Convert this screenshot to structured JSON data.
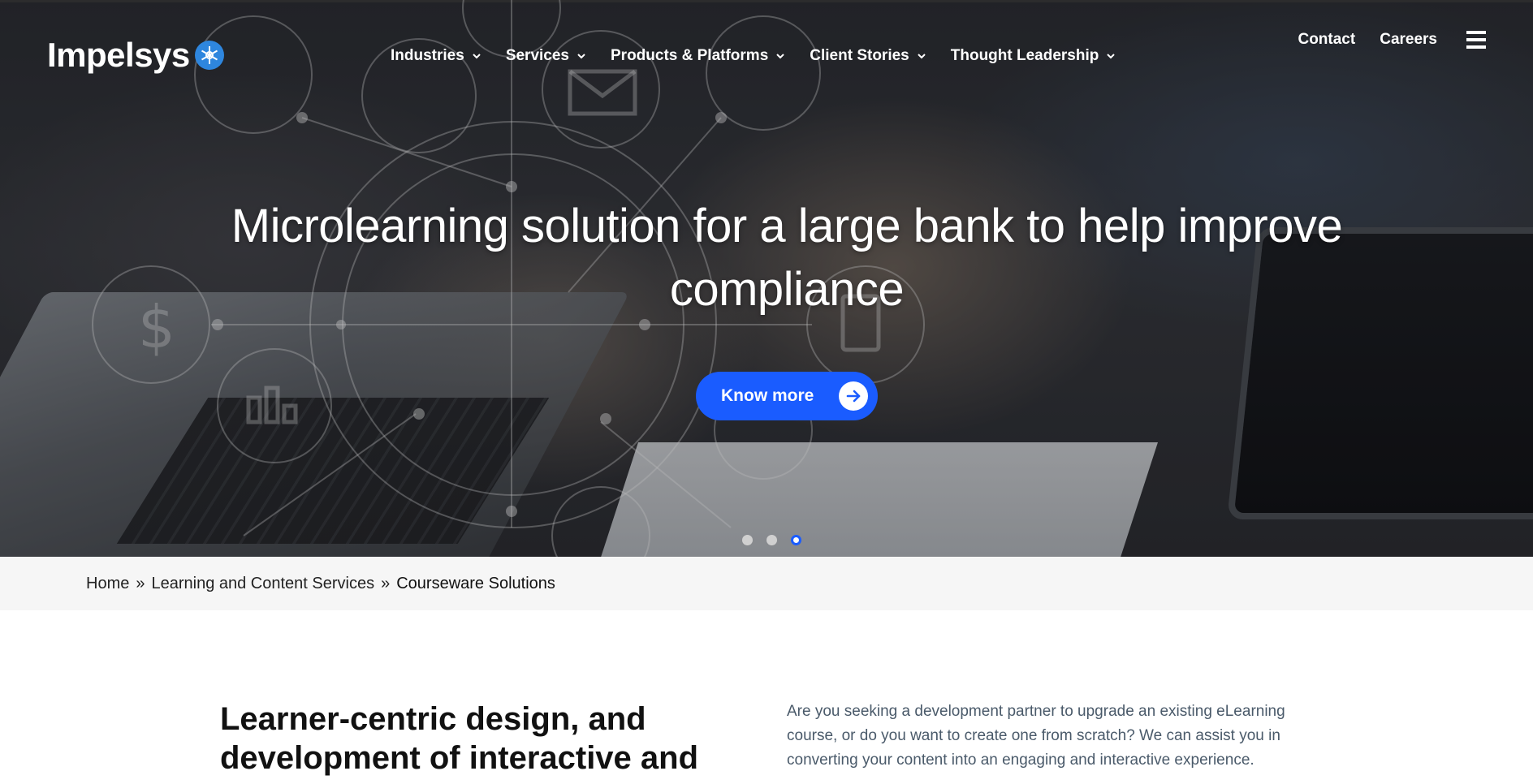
{
  "brand": {
    "name": "Impelsys",
    "logo_color": "#2e86de"
  },
  "nav": {
    "items": [
      {
        "label": "Industries",
        "icon": "chevron-down-icon"
      },
      {
        "label": "Services",
        "icon": "chevron-down-icon"
      },
      {
        "label": "Products & Platforms",
        "icon": "chevron-down-icon"
      },
      {
        "label": "Client Stories",
        "icon": "chevron-down-icon"
      },
      {
        "label": "Thought Leadership",
        "icon": "chevron-down-icon"
      }
    ],
    "top_links": [
      "Contact",
      "Careers"
    ],
    "menu_icon": "hamburger-menu-icon"
  },
  "hero": {
    "title": "Microlearning solution for a large bank to help improve compliance",
    "cta_label": "Know more",
    "cta_icon": "arrow-right-icon",
    "cta_color": "#1a5cff",
    "slides_total": 3,
    "active_slide": 3
  },
  "breadcrumb": {
    "items": [
      "Home",
      "Learning and Content Services"
    ],
    "separator": "»",
    "current": "Courseware Solutions"
  },
  "intro": {
    "heading": "Learner-centric design, and development of interactive and",
    "body": "Are you seeking a development partner to upgrade an existing eLearning course, or do you want to create one from scratch? We can assist you in converting your content into an engaging and interactive experience."
  }
}
